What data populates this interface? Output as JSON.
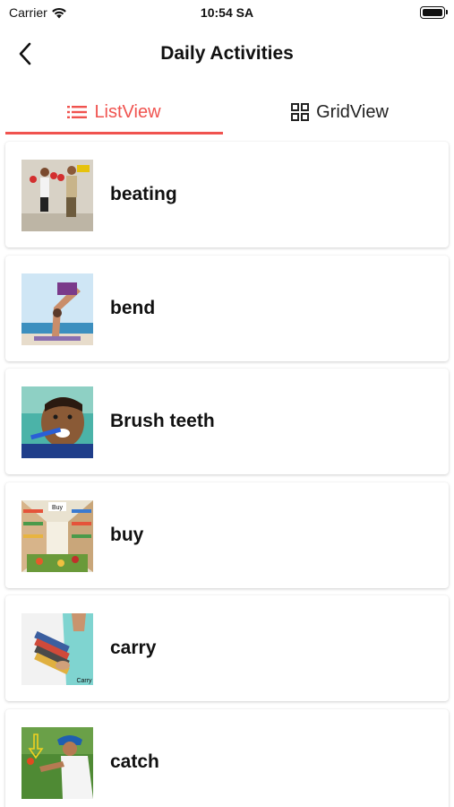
{
  "status_bar": {
    "carrier": "Carrier",
    "time": "10:54 SA"
  },
  "app_bar": {
    "title": "Daily Activities",
    "back_icon": "chevron-left-icon"
  },
  "tabs": [
    {
      "label": "ListView",
      "icon": "list-icon",
      "active": true
    },
    {
      "label": "GridView",
      "icon": "grid-icon",
      "active": false
    }
  ],
  "items": [
    {
      "label": "beating"
    },
    {
      "label": "bend"
    },
    {
      "label": "Brush teeth"
    },
    {
      "label": "buy",
      "image_text": "Buy"
    },
    {
      "label": "carry",
      "image_text": "Carry"
    },
    {
      "label": "catch"
    }
  ],
  "colors": {
    "accent": "#f0534f",
    "text": "#111111",
    "background": "#ffffff"
  }
}
